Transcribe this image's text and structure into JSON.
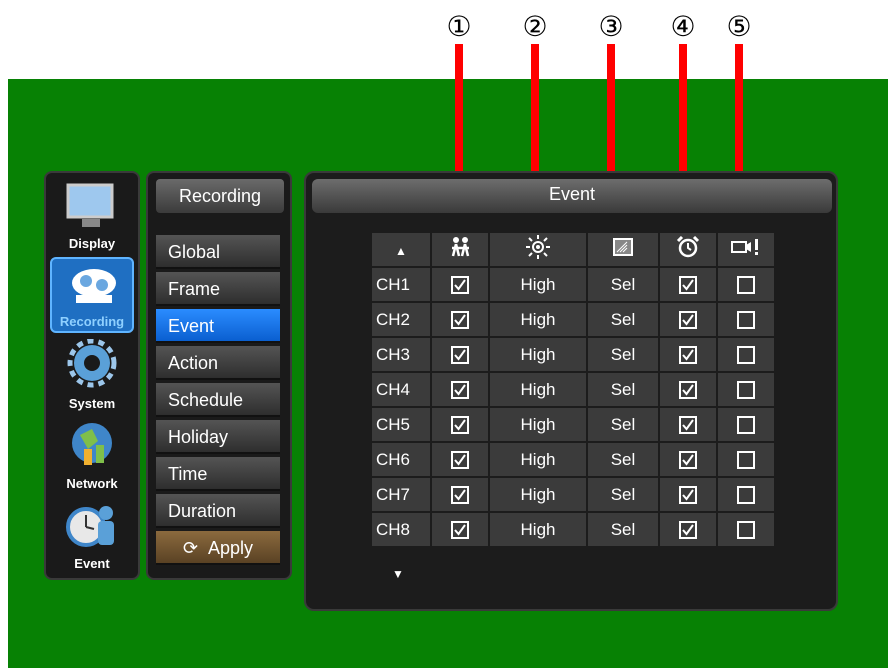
{
  "callouts": [
    "①",
    "②",
    "③",
    "④",
    "⑤"
  ],
  "sidebar": {
    "items": [
      {
        "label": "Display",
        "icon": "monitor-icon"
      },
      {
        "label": "Recording",
        "icon": "recording-icon"
      },
      {
        "label": "System",
        "icon": "gear-icon"
      },
      {
        "label": "Network",
        "icon": "globe-icon"
      },
      {
        "label": "Event",
        "icon": "clock-person-icon"
      }
    ]
  },
  "menu": {
    "title": "Recording",
    "items": [
      "Global",
      "Frame",
      "Event",
      "Action",
      "Schedule",
      "Holiday",
      "Time",
      "Duration"
    ],
    "apply_label": "Apply"
  },
  "panel": {
    "title": "Event",
    "columns": [
      "motion-icon",
      "sensitivity-icon",
      "area-icon",
      "alarm-icon",
      "video-loss-icon"
    ],
    "rows": [
      {
        "ch": "CH1",
        "motion": true,
        "sensitivity": "High",
        "area": "Sel",
        "alarm": true,
        "video_loss": false
      },
      {
        "ch": "CH2",
        "motion": true,
        "sensitivity": "High",
        "area": "Sel",
        "alarm": true,
        "video_loss": false
      },
      {
        "ch": "CH3",
        "motion": true,
        "sensitivity": "High",
        "area": "Sel",
        "alarm": true,
        "video_loss": false
      },
      {
        "ch": "CH4",
        "motion": true,
        "sensitivity": "High",
        "area": "Sel",
        "alarm": true,
        "video_loss": false
      },
      {
        "ch": "CH5",
        "motion": true,
        "sensitivity": "High",
        "area": "Sel",
        "alarm": true,
        "video_loss": false
      },
      {
        "ch": "CH6",
        "motion": true,
        "sensitivity": "High",
        "area": "Sel",
        "alarm": true,
        "video_loss": false
      },
      {
        "ch": "CH7",
        "motion": true,
        "sensitivity": "High",
        "area": "Sel",
        "alarm": true,
        "video_loss": false
      },
      {
        "ch": "CH8",
        "motion": true,
        "sensitivity": "High",
        "area": "Sel",
        "alarm": true,
        "video_loss": false
      }
    ]
  },
  "colors": {
    "background": "#078104",
    "accent": "#0a5fd0",
    "arrow": "#ff0000"
  }
}
